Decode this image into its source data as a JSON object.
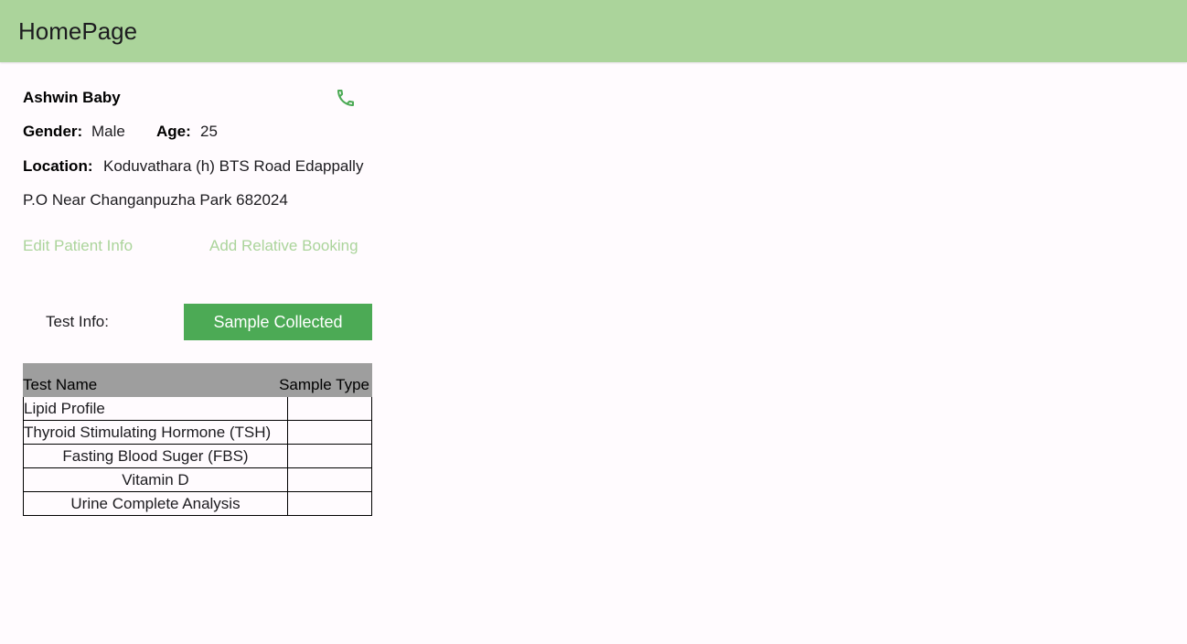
{
  "appbar": {
    "title": "HomePage"
  },
  "patient": {
    "name": "Ashwin Baby",
    "gender_label": "Gender:",
    "gender": "Male",
    "age_label": "Age:",
    "age": "25",
    "location_label": "Location:",
    "location_line1": "Koduvathara (h) BTS Road Edappally",
    "location_line2": "P.O Near Changanpuzha Park 682024",
    "call_icon": "phone-icon"
  },
  "actions": {
    "edit_label": "Edit Patient Info",
    "relative_label": "Add Relative Booking"
  },
  "test_info": {
    "label": "Test Info:",
    "status_button": "Sample Collected"
  },
  "table": {
    "headers": {
      "name": "Test Name",
      "type": "Sample Type"
    },
    "rows": [
      {
        "name": "Lipid Profile",
        "type": ""
      },
      {
        "name": "Thyroid Stimulating Hormone (TSH)",
        "type": ""
      },
      {
        "name": "Fasting Blood Suger (FBS)",
        "type": ""
      },
      {
        "name": "Vitamin D",
        "type": ""
      },
      {
        "name": "Urine Complete Analysis",
        "type": ""
      }
    ]
  },
  "colors": {
    "appbar": "#abd49b",
    "accent": "#4caa55",
    "link": "#abd49b",
    "table_header": "#9e9e9e"
  }
}
